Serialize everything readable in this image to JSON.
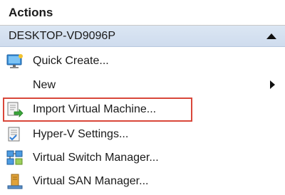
{
  "panel": {
    "title": "Actions"
  },
  "host": {
    "name": "DESKTOP-VD9096P"
  },
  "menu": {
    "items": [
      {
        "label": "Quick Create...",
        "icon": "quick-create-icon"
      },
      {
        "label": "New",
        "icon": "",
        "has_submenu": true
      },
      {
        "label": "Import Virtual Machine...",
        "icon": "import-vm-icon",
        "highlighted": true
      },
      {
        "label": "Hyper-V Settings...",
        "icon": "settings-icon"
      },
      {
        "label": "Virtual Switch Manager...",
        "icon": "switch-manager-icon"
      },
      {
        "label": "Virtual SAN Manager...",
        "icon": "san-manager-icon"
      }
    ]
  },
  "colors": {
    "host_bar": "#d6e2f1",
    "highlight_border": "#d9473a"
  }
}
